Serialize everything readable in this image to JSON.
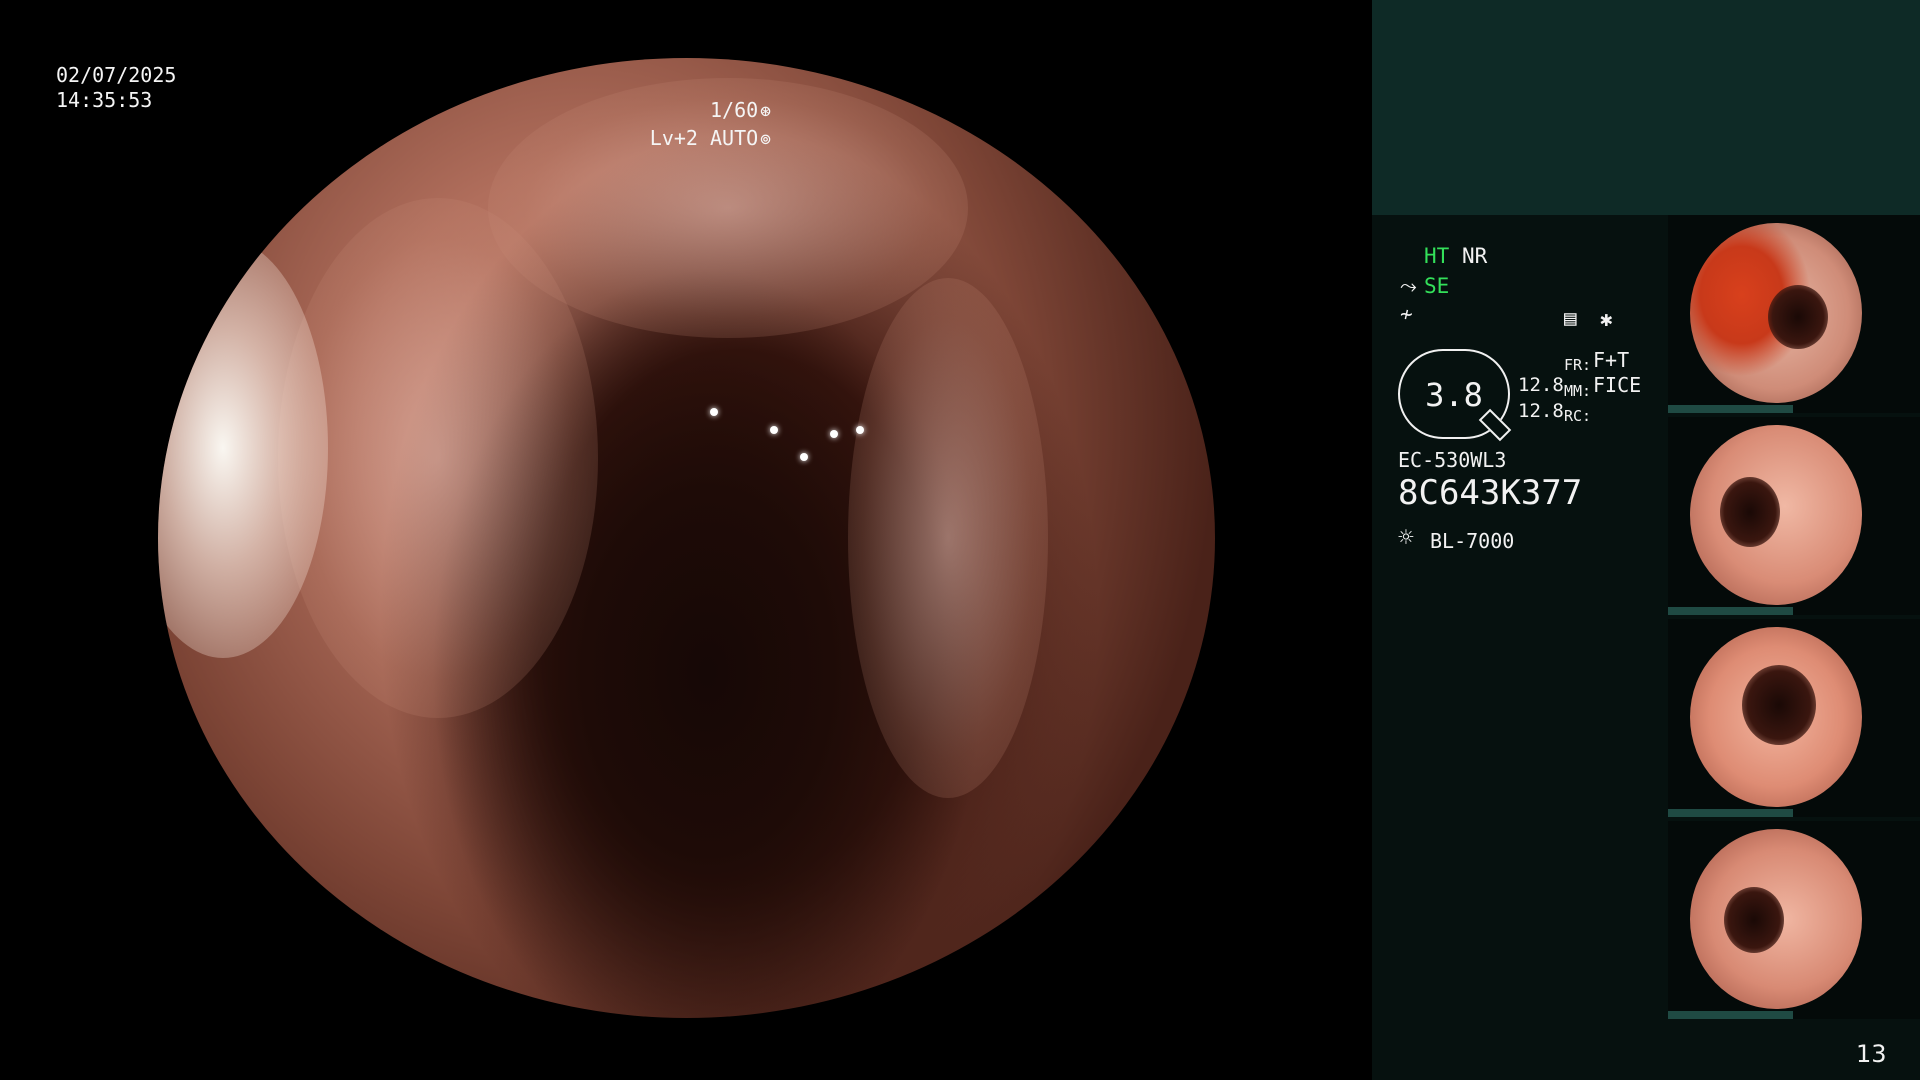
{
  "osd": {
    "date": "02/07/2025",
    "time": "14:35:53",
    "shutter": "1/60",
    "level": "Lv+2 AUTO"
  },
  "side_panel": {
    "modes": {
      "ht": "HT",
      "nr": "NR",
      "se": "SE"
    },
    "zoom": "3.8",
    "size_1": "12.8",
    "size_2": "12.8",
    "fr_label": "FR:",
    "fr_value": "F+T",
    "mm_label": "MM:",
    "mm_value": "FICE",
    "rc_label": "RC:",
    "scope_model": "EC-530WL3",
    "scope_serial": "8C643K377",
    "light_source": "BL-7000",
    "page_number": "13"
  },
  "icons": {
    "shutter": "aperture-icon",
    "level": "iris-icon",
    "se": "scope-tip-icon",
    "edge": "edge-enhance-icon",
    "scan": "scan-mode-icon",
    "star": "asterisk-icon",
    "light": "light-source-icon"
  },
  "colors": {
    "mode_green": "#33e05a",
    "panel_top": "#0e2a26",
    "panel_bg": "#06110f"
  }
}
